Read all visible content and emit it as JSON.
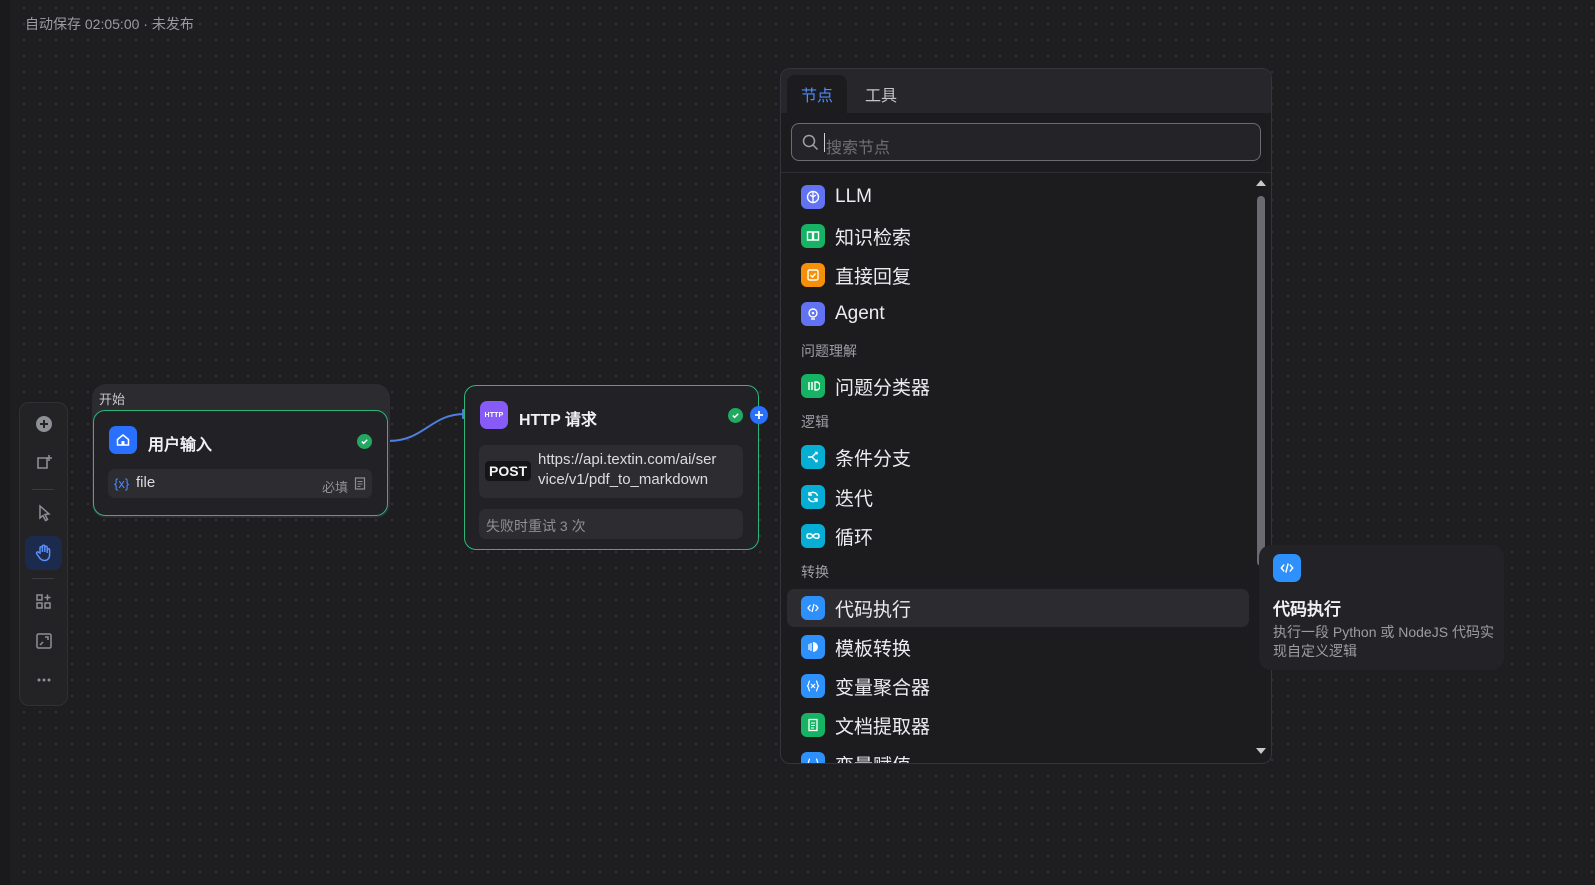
{
  "header": {
    "autosave_text": "自动保存 02:05:00 · 未发布"
  },
  "toolbar": {
    "items": [
      {
        "icon": "add-circle-icon"
      },
      {
        "icon": "add-note-icon"
      },
      {
        "icon": "pointer-icon"
      },
      {
        "icon": "hand-icon",
        "active": true
      },
      {
        "icon": "organize-blocks-icon"
      },
      {
        "icon": "minimap-icon"
      },
      {
        "icon": "more-icon"
      }
    ]
  },
  "canvas": {
    "start_group": {
      "label": "开始",
      "node": {
        "title": "用户输入",
        "field": {
          "var_icon": "{x}",
          "name": "file",
          "required": "必填"
        }
      }
    },
    "http_node": {
      "icon_text": "HTTP",
      "title": "HTTP 请求",
      "method": "POST",
      "url": "https://api.textin.com/ai/service/v1/pdf_to_markdown",
      "url_line1": "https://api.textin.com/ai/ser",
      "url_line2": "vice/v1/pdf_to_markdown",
      "retry_text": "失败时重试 3 次"
    }
  },
  "panel": {
    "tabs": [
      {
        "label": "节点",
        "active": true
      },
      {
        "label": "工具",
        "active": false
      }
    ],
    "search": {
      "placeholder": "搜索节点"
    },
    "items": [
      {
        "label": "LLM",
        "icon": "llm-icon",
        "color": "#6172f3"
      },
      {
        "label": "知识检索",
        "icon": "knowledge-retrieval-icon",
        "color": "#16b364"
      },
      {
        "label": "直接回复",
        "icon": "direct-reply-icon",
        "color": "#f79009"
      },
      {
        "label": "Agent",
        "icon": "agent-icon",
        "color": "#6172f3"
      },
      {
        "label": "问题分类器",
        "icon": "question-classifier-icon",
        "color": "#16b364"
      },
      {
        "label": "条件分支",
        "icon": "if-else-icon",
        "color": "#06aed4"
      },
      {
        "label": "迭代",
        "icon": "iteration-icon",
        "color": "#06aed4"
      },
      {
        "label": "循环",
        "icon": "loop-icon",
        "color": "#06aed4"
      },
      {
        "label": "代码执行",
        "icon": "code-icon",
        "color": "#2e90fa"
      },
      {
        "label": "模板转换",
        "icon": "template-transform-icon",
        "color": "#2e90fa"
      },
      {
        "label": "变量聚合器",
        "icon": "variable-aggregator-icon",
        "color": "#2e90fa"
      },
      {
        "label": "文档提取器",
        "icon": "doc-extractor-icon",
        "color": "#16b364"
      },
      {
        "label": "变量赋值",
        "icon": "variable-assigner-icon",
        "color": "#2e90fa"
      }
    ],
    "sections": {
      "question": "问题理解",
      "logic": "逻辑",
      "transform": "转换"
    }
  },
  "tooltip": {
    "title": "代码执行",
    "description": "执行一段 Python 或 NodeJS 代码实现自定义逻辑"
  },
  "colors": {
    "success": "#22a861",
    "accent": "#4d8bff",
    "node_border": "#2fb57a"
  }
}
